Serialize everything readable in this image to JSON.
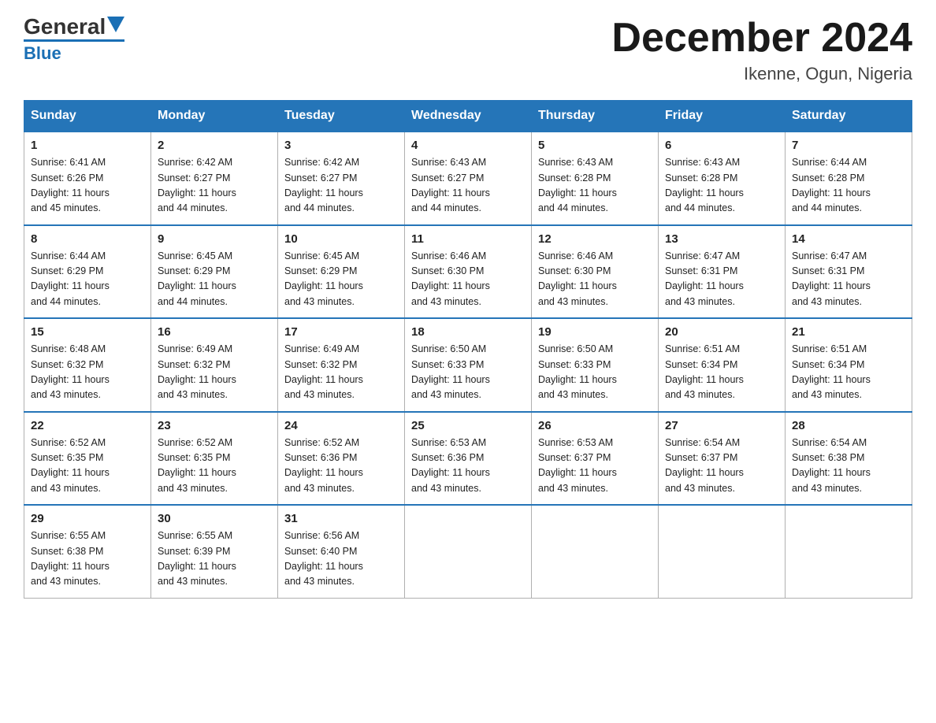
{
  "header": {
    "logo_general": "General",
    "logo_blue": "Blue",
    "month_title": "December 2024",
    "location": "Ikenne, Ogun, Nigeria"
  },
  "days_of_week": [
    "Sunday",
    "Monday",
    "Tuesday",
    "Wednesday",
    "Thursday",
    "Friday",
    "Saturday"
  ],
  "weeks": [
    [
      {
        "day": "1",
        "sunrise": "6:41 AM",
        "sunset": "6:26 PM",
        "daylight": "11 hours and 45 minutes."
      },
      {
        "day": "2",
        "sunrise": "6:42 AM",
        "sunset": "6:27 PM",
        "daylight": "11 hours and 44 minutes."
      },
      {
        "day": "3",
        "sunrise": "6:42 AM",
        "sunset": "6:27 PM",
        "daylight": "11 hours and 44 minutes."
      },
      {
        "day": "4",
        "sunrise": "6:43 AM",
        "sunset": "6:27 PM",
        "daylight": "11 hours and 44 minutes."
      },
      {
        "day": "5",
        "sunrise": "6:43 AM",
        "sunset": "6:28 PM",
        "daylight": "11 hours and 44 minutes."
      },
      {
        "day": "6",
        "sunrise": "6:43 AM",
        "sunset": "6:28 PM",
        "daylight": "11 hours and 44 minutes."
      },
      {
        "day": "7",
        "sunrise": "6:44 AM",
        "sunset": "6:28 PM",
        "daylight": "11 hours and 44 minutes."
      }
    ],
    [
      {
        "day": "8",
        "sunrise": "6:44 AM",
        "sunset": "6:29 PM",
        "daylight": "11 hours and 44 minutes."
      },
      {
        "day": "9",
        "sunrise": "6:45 AM",
        "sunset": "6:29 PM",
        "daylight": "11 hours and 44 minutes."
      },
      {
        "day": "10",
        "sunrise": "6:45 AM",
        "sunset": "6:29 PM",
        "daylight": "11 hours and 43 minutes."
      },
      {
        "day": "11",
        "sunrise": "6:46 AM",
        "sunset": "6:30 PM",
        "daylight": "11 hours and 43 minutes."
      },
      {
        "day": "12",
        "sunrise": "6:46 AM",
        "sunset": "6:30 PM",
        "daylight": "11 hours and 43 minutes."
      },
      {
        "day": "13",
        "sunrise": "6:47 AM",
        "sunset": "6:31 PM",
        "daylight": "11 hours and 43 minutes."
      },
      {
        "day": "14",
        "sunrise": "6:47 AM",
        "sunset": "6:31 PM",
        "daylight": "11 hours and 43 minutes."
      }
    ],
    [
      {
        "day": "15",
        "sunrise": "6:48 AM",
        "sunset": "6:32 PM",
        "daylight": "11 hours and 43 minutes."
      },
      {
        "day": "16",
        "sunrise": "6:49 AM",
        "sunset": "6:32 PM",
        "daylight": "11 hours and 43 minutes."
      },
      {
        "day": "17",
        "sunrise": "6:49 AM",
        "sunset": "6:32 PM",
        "daylight": "11 hours and 43 minutes."
      },
      {
        "day": "18",
        "sunrise": "6:50 AM",
        "sunset": "6:33 PM",
        "daylight": "11 hours and 43 minutes."
      },
      {
        "day": "19",
        "sunrise": "6:50 AM",
        "sunset": "6:33 PM",
        "daylight": "11 hours and 43 minutes."
      },
      {
        "day": "20",
        "sunrise": "6:51 AM",
        "sunset": "6:34 PM",
        "daylight": "11 hours and 43 minutes."
      },
      {
        "day": "21",
        "sunrise": "6:51 AM",
        "sunset": "6:34 PM",
        "daylight": "11 hours and 43 minutes."
      }
    ],
    [
      {
        "day": "22",
        "sunrise": "6:52 AM",
        "sunset": "6:35 PM",
        "daylight": "11 hours and 43 minutes."
      },
      {
        "day": "23",
        "sunrise": "6:52 AM",
        "sunset": "6:35 PM",
        "daylight": "11 hours and 43 minutes."
      },
      {
        "day": "24",
        "sunrise": "6:52 AM",
        "sunset": "6:36 PM",
        "daylight": "11 hours and 43 minutes."
      },
      {
        "day": "25",
        "sunrise": "6:53 AM",
        "sunset": "6:36 PM",
        "daylight": "11 hours and 43 minutes."
      },
      {
        "day": "26",
        "sunrise": "6:53 AM",
        "sunset": "6:37 PM",
        "daylight": "11 hours and 43 minutes."
      },
      {
        "day": "27",
        "sunrise": "6:54 AM",
        "sunset": "6:37 PM",
        "daylight": "11 hours and 43 minutes."
      },
      {
        "day": "28",
        "sunrise": "6:54 AM",
        "sunset": "6:38 PM",
        "daylight": "11 hours and 43 minutes."
      }
    ],
    [
      {
        "day": "29",
        "sunrise": "6:55 AM",
        "sunset": "6:38 PM",
        "daylight": "11 hours and 43 minutes."
      },
      {
        "day": "30",
        "sunrise": "6:55 AM",
        "sunset": "6:39 PM",
        "daylight": "11 hours and 43 minutes."
      },
      {
        "day": "31",
        "sunrise": "6:56 AM",
        "sunset": "6:40 PM",
        "daylight": "11 hours and 43 minutes."
      },
      null,
      null,
      null,
      null
    ]
  ],
  "labels": {
    "sunrise": "Sunrise:",
    "sunset": "Sunset:",
    "daylight": "Daylight:"
  }
}
